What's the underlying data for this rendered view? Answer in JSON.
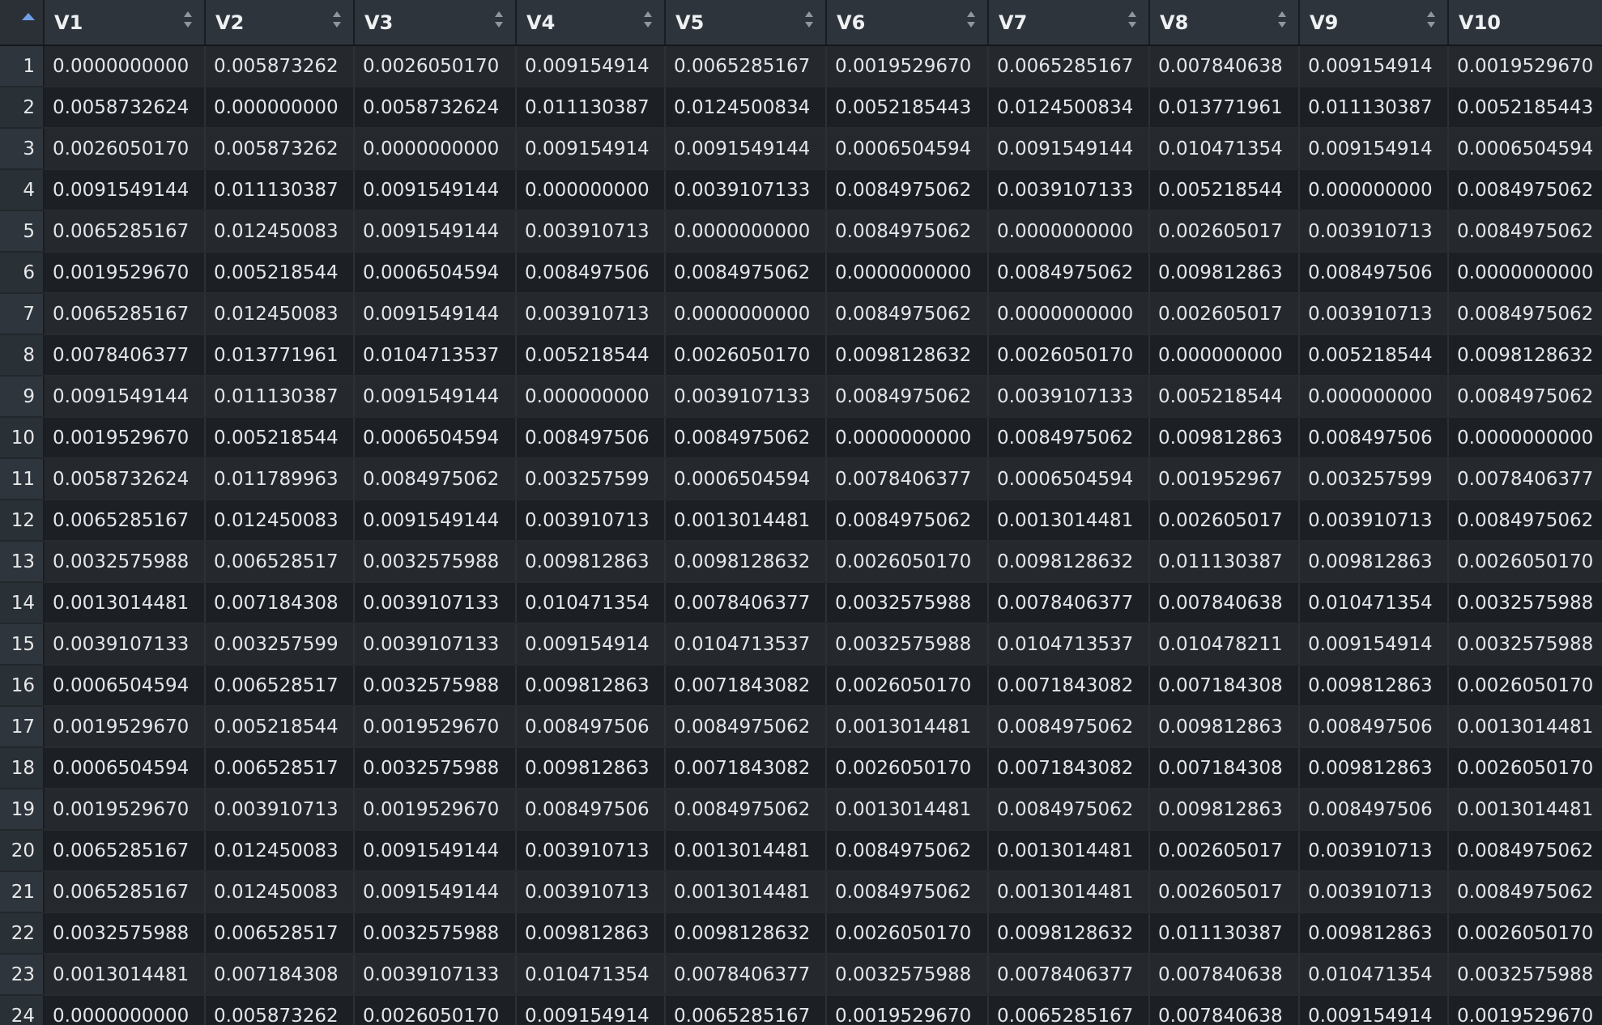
{
  "columns": [
    "V1",
    "V2",
    "V3",
    "V4",
    "V5",
    "V6",
    "V7",
    "V8",
    "V9",
    "V10"
  ],
  "row_numbers": [
    "1",
    "2",
    "3",
    "4",
    "5",
    "6",
    "7",
    "8",
    "9",
    "10",
    "11",
    "12",
    "13",
    "14",
    "15",
    "16",
    "17",
    "18",
    "19",
    "20",
    "21",
    "22",
    "23",
    "24"
  ],
  "rows": [
    [
      "0.0000000000",
      "0.005873262",
      "0.0026050170",
      "0.009154914",
      "0.0065285167",
      "0.0019529670",
      "0.0065285167",
      "0.007840638",
      "0.009154914",
      "0.0019529670"
    ],
    [
      "0.0058732624",
      "0.000000000",
      "0.0058732624",
      "0.011130387",
      "0.0124500834",
      "0.0052185443",
      "0.0124500834",
      "0.013771961",
      "0.011130387",
      "0.0052185443"
    ],
    [
      "0.0026050170",
      "0.005873262",
      "0.0000000000",
      "0.009154914",
      "0.0091549144",
      "0.0006504594",
      "0.0091549144",
      "0.010471354",
      "0.009154914",
      "0.0006504594"
    ],
    [
      "0.0091549144",
      "0.011130387",
      "0.0091549144",
      "0.000000000",
      "0.0039107133",
      "0.0084975062",
      "0.0039107133",
      "0.005218544",
      "0.000000000",
      "0.0084975062"
    ],
    [
      "0.0065285167",
      "0.012450083",
      "0.0091549144",
      "0.003910713",
      "0.0000000000",
      "0.0084975062",
      "0.0000000000",
      "0.002605017",
      "0.003910713",
      "0.0084975062"
    ],
    [
      "0.0019529670",
      "0.005218544",
      "0.0006504594",
      "0.008497506",
      "0.0084975062",
      "0.0000000000",
      "0.0084975062",
      "0.009812863",
      "0.008497506",
      "0.0000000000"
    ],
    [
      "0.0065285167",
      "0.012450083",
      "0.0091549144",
      "0.003910713",
      "0.0000000000",
      "0.0084975062",
      "0.0000000000",
      "0.002605017",
      "0.003910713",
      "0.0084975062"
    ],
    [
      "0.0078406377",
      "0.013771961",
      "0.0104713537",
      "0.005218544",
      "0.0026050170",
      "0.0098128632",
      "0.0026050170",
      "0.000000000",
      "0.005218544",
      "0.0098128632"
    ],
    [
      "0.0091549144",
      "0.011130387",
      "0.0091549144",
      "0.000000000",
      "0.0039107133",
      "0.0084975062",
      "0.0039107133",
      "0.005218544",
      "0.000000000",
      "0.0084975062"
    ],
    [
      "0.0019529670",
      "0.005218544",
      "0.0006504594",
      "0.008497506",
      "0.0084975062",
      "0.0000000000",
      "0.0084975062",
      "0.009812863",
      "0.008497506",
      "0.0000000000"
    ],
    [
      "0.0058732624",
      "0.011789963",
      "0.0084975062",
      "0.003257599",
      "0.0006504594",
      "0.0078406377",
      "0.0006504594",
      "0.001952967",
      "0.003257599",
      "0.0078406377"
    ],
    [
      "0.0065285167",
      "0.012450083",
      "0.0091549144",
      "0.003910713",
      "0.0013014481",
      "0.0084975062",
      "0.0013014481",
      "0.002605017",
      "0.003910713",
      "0.0084975062"
    ],
    [
      "0.0032575988",
      "0.006528517",
      "0.0032575988",
      "0.009812863",
      "0.0098128632",
      "0.0026050170",
      "0.0098128632",
      "0.011130387",
      "0.009812863",
      "0.0026050170"
    ],
    [
      "0.0013014481",
      "0.007184308",
      "0.0039107133",
      "0.010471354",
      "0.0078406377",
      "0.0032575988",
      "0.0078406377",
      "0.007840638",
      "0.010471354",
      "0.0032575988"
    ],
    [
      "0.0039107133",
      "0.003257599",
      "0.0039107133",
      "0.009154914",
      "0.0104713537",
      "0.0032575988",
      "0.0104713537",
      "0.010478211",
      "0.009154914",
      "0.0032575988"
    ],
    [
      "0.0006504594",
      "0.006528517",
      "0.0032575988",
      "0.009812863",
      "0.0071843082",
      "0.0026050170",
      "0.0071843082",
      "0.007184308",
      "0.009812863",
      "0.0026050170"
    ],
    [
      "0.0019529670",
      "0.005218544",
      "0.0019529670",
      "0.008497506",
      "0.0084975062",
      "0.0013014481",
      "0.0084975062",
      "0.009812863",
      "0.008497506",
      "0.0013014481"
    ],
    [
      "0.0006504594",
      "0.006528517",
      "0.0032575988",
      "0.009812863",
      "0.0071843082",
      "0.0026050170",
      "0.0071843082",
      "0.007184308",
      "0.009812863",
      "0.0026050170"
    ],
    [
      "0.0019529670",
      "0.003910713",
      "0.0019529670",
      "0.008497506",
      "0.0084975062",
      "0.0013014481",
      "0.0084975062",
      "0.009812863",
      "0.008497506",
      "0.0013014481"
    ],
    [
      "0.0065285167",
      "0.012450083",
      "0.0091549144",
      "0.003910713",
      "0.0013014481",
      "0.0084975062",
      "0.0013014481",
      "0.002605017",
      "0.003910713",
      "0.0084975062"
    ],
    [
      "0.0065285167",
      "0.012450083",
      "0.0091549144",
      "0.003910713",
      "0.0013014481",
      "0.0084975062",
      "0.0013014481",
      "0.002605017",
      "0.003910713",
      "0.0084975062"
    ],
    [
      "0.0032575988",
      "0.006528517",
      "0.0032575988",
      "0.009812863",
      "0.0098128632",
      "0.0026050170",
      "0.0098128632",
      "0.011130387",
      "0.009812863",
      "0.0026050170"
    ],
    [
      "0.0013014481",
      "0.007184308",
      "0.0039107133",
      "0.010471354",
      "0.0078406377",
      "0.0032575988",
      "0.0078406377",
      "0.007840638",
      "0.010471354",
      "0.0032575988"
    ],
    [
      "0.0000000000",
      "0.005873262",
      "0.0026050170",
      "0.009154914",
      "0.0065285167",
      "0.0019529670",
      "0.0065285167",
      "0.007840638",
      "0.009154914",
      "0.0019529670"
    ]
  ],
  "colors": {
    "header_bg": "#2d343b",
    "row_odd_bg": "#25292d",
    "row_even_bg": "#1c2024",
    "sort_active_accent": "#6fa0e6",
    "text": "#e3e6e9"
  },
  "icons": {
    "corner": "sort-ascending-icon",
    "column_sort": "sort-arrows-icon"
  }
}
